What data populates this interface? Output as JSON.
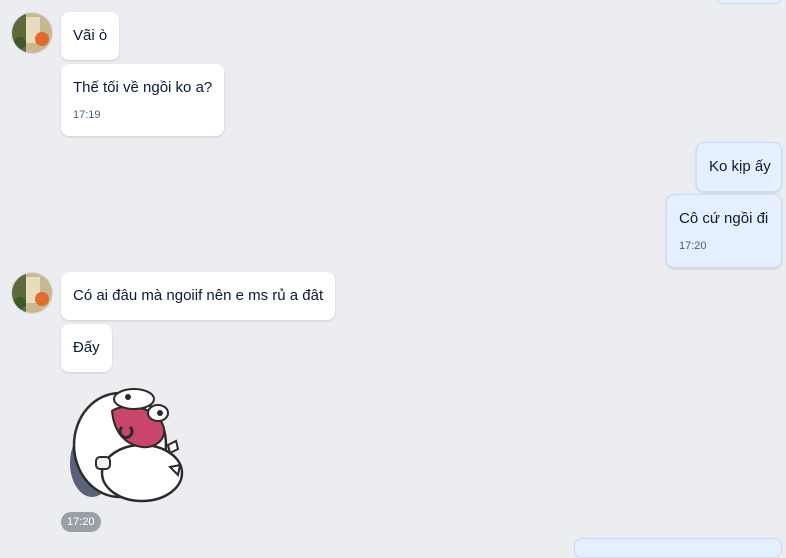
{
  "messages": [
    {
      "text": "Vãi ò"
    },
    {
      "text": "Thế tối về ngồi ko a?",
      "time": "17:19"
    },
    {
      "text": "Ko kịp ấy"
    },
    {
      "text": "Cô cứ ngồi đi",
      "time": "17:20"
    },
    {
      "text": "Có ai đâu mà ngoiif nên e ms rủ a đât"
    },
    {
      "text": "Đấy"
    }
  ],
  "sticker": {
    "icon": "cat-sticker",
    "time": "17:20"
  },
  "colors": {
    "background": "#ebedf0",
    "incoming_bubble": "#ffffff",
    "outgoing_bubble": "#e5efff"
  }
}
